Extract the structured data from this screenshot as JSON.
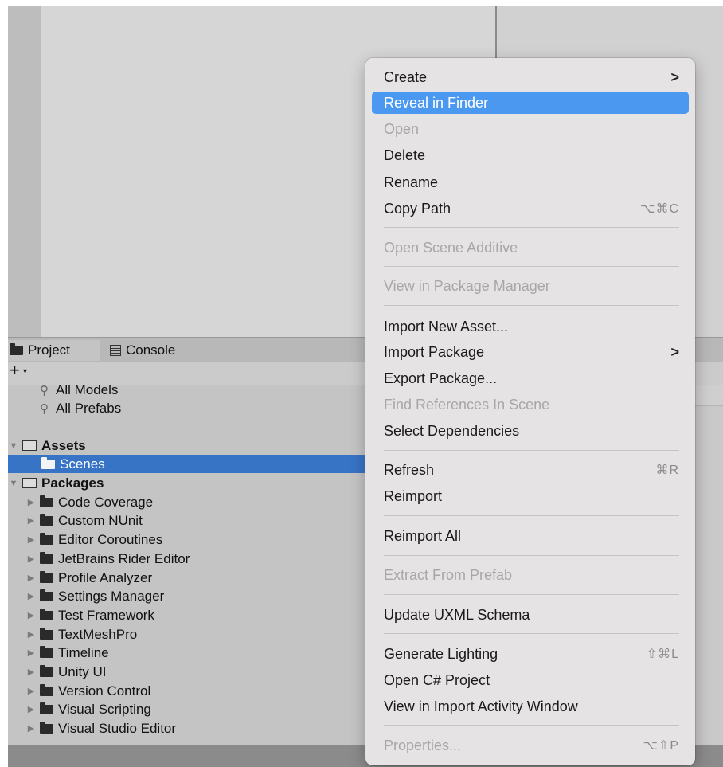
{
  "tabs": {
    "project": "Project",
    "console": "Console"
  },
  "toolbar": {
    "add": "+",
    "caret": "▾"
  },
  "favorites": [
    {
      "label": "All Models"
    },
    {
      "label": "All Prefabs"
    }
  ],
  "assets": {
    "label": "Assets",
    "children": [
      {
        "label": "Scenes",
        "selected": true
      }
    ]
  },
  "packages": {
    "label": "Packages",
    "children": [
      {
        "label": "Code Coverage"
      },
      {
        "label": "Custom NUnit"
      },
      {
        "label": "Editor Coroutines"
      },
      {
        "label": "JetBrains Rider Editor"
      },
      {
        "label": "Profile Analyzer"
      },
      {
        "label": "Settings Manager"
      },
      {
        "label": "Test Framework"
      },
      {
        "label": "TextMeshPro"
      },
      {
        "label": "Timeline"
      },
      {
        "label": "Unity UI"
      },
      {
        "label": "Version Control"
      },
      {
        "label": "Visual Scripting"
      },
      {
        "label": "Visual Studio Editor"
      }
    ]
  },
  "context_menu": {
    "items": [
      {
        "label": "Create",
        "submenu": true
      },
      {
        "label": "Reveal in Finder",
        "highlighted": true
      },
      {
        "label": "Open",
        "disabled": true
      },
      {
        "label": "Delete"
      },
      {
        "label": "Rename"
      },
      {
        "label": "Copy Path",
        "shortcut": "⌥⌘C"
      },
      {
        "label": "Open Scene Additive",
        "disabled": true
      },
      {
        "label": "View in Package Manager",
        "disabled": true
      },
      {
        "label": "Import New Asset..."
      },
      {
        "label": "Import Package",
        "submenu": true
      },
      {
        "label": "Export Package..."
      },
      {
        "label": "Find References In Scene",
        "disabled": true
      },
      {
        "label": "Select Dependencies"
      },
      {
        "label": "Refresh",
        "shortcut": "⌘R"
      },
      {
        "label": "Reimport"
      },
      {
        "label": "Reimport All"
      },
      {
        "label": "Extract From Prefab",
        "disabled": true
      },
      {
        "label": "Update UXML Schema"
      },
      {
        "label": "Generate Lighting",
        "shortcut": "⇧⌘L"
      },
      {
        "label": "Open C# Project"
      },
      {
        "label": "View in Import Activity Window"
      },
      {
        "label": "Properties...",
        "shortcut": "⌥⇧P",
        "disabled": true
      }
    ],
    "submenu_glyph": ">"
  },
  "colors": {
    "selection": "#3874c6",
    "menu_highlight": "#4b98f0",
    "menu_background": "#e6e3e5",
    "panel_background": "#c4c4c4"
  }
}
